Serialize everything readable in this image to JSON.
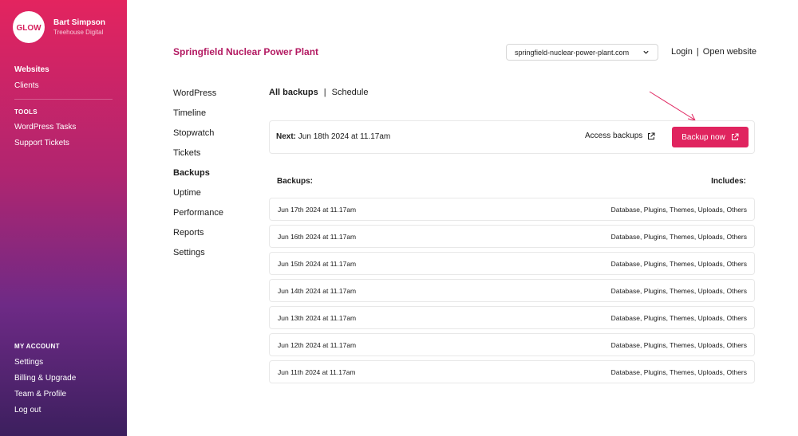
{
  "brand": {
    "logo_text": "GLOW"
  },
  "user": {
    "name": "Bart Simpson",
    "org": "Treehouse Digital"
  },
  "sidebar": {
    "main": [
      {
        "label": "Websites",
        "active": true
      },
      {
        "label": "Clients",
        "active": false
      }
    ],
    "tools_title": "TOOLS",
    "tools": [
      {
        "label": "WordPress Tasks"
      },
      {
        "label": "Support Tickets"
      }
    ],
    "account_title": "MY ACCOUNT",
    "account": [
      {
        "label": "Settings"
      },
      {
        "label": "Billing & Upgrade"
      },
      {
        "label": "Team & Profile"
      },
      {
        "label": "Log out"
      }
    ]
  },
  "header": {
    "site_title": "Springfield Nuclear Power Plant",
    "domain": "springfield-nuclear-power-plant.com",
    "login": "Login",
    "separator": "|",
    "open_website": "Open website"
  },
  "subnav": [
    {
      "label": "WordPress"
    },
    {
      "label": "Timeline"
    },
    {
      "label": "Stopwatch"
    },
    {
      "label": "Tickets"
    },
    {
      "label": "Backups",
      "active": true
    },
    {
      "label": "Uptime"
    },
    {
      "label": "Performance"
    },
    {
      "label": "Reports"
    },
    {
      "label": "Settings"
    }
  ],
  "tabs": {
    "all": "All backups",
    "separator": "|",
    "schedule": "Schedule"
  },
  "next_backup": {
    "label": "Next:",
    "value": "Jun 18th 2024 at 11.17am",
    "access_label": "Access backups",
    "backup_now_label": "Backup now"
  },
  "list": {
    "header_left": "Backups:",
    "header_right": "Includes:",
    "rows": [
      {
        "date": "Jun 17th 2024 at 11.17am",
        "includes": "Database, Plugins, Themes, Uploads, Others"
      },
      {
        "date": "Jun 16th 2024 at 11.17am",
        "includes": "Database, Plugins, Themes, Uploads, Others"
      },
      {
        "date": "Jun 15th 2024 at 11.17am",
        "includes": "Database, Plugins, Themes, Uploads, Others"
      },
      {
        "date": "Jun 14th 2024 at 11.17am",
        "includes": "Database, Plugins, Themes, Uploads, Others"
      },
      {
        "date": "Jun 13th 2024 at 11.17am",
        "includes": "Database, Plugins, Themes, Uploads, Others"
      },
      {
        "date": "Jun 12th 2024 at 11.17am",
        "includes": "Database, Plugins, Themes, Uploads, Others"
      },
      {
        "date": "Jun 11th 2024 at 11.17am",
        "includes": "Database, Plugins, Themes, Uploads, Others"
      }
    ]
  },
  "colors": {
    "accent": "#e0245f",
    "title": "#b31a62"
  },
  "icons": {
    "external": "external-link-icon",
    "dropdown": "chevron-down-icon",
    "annotation": "arrow-icon"
  }
}
